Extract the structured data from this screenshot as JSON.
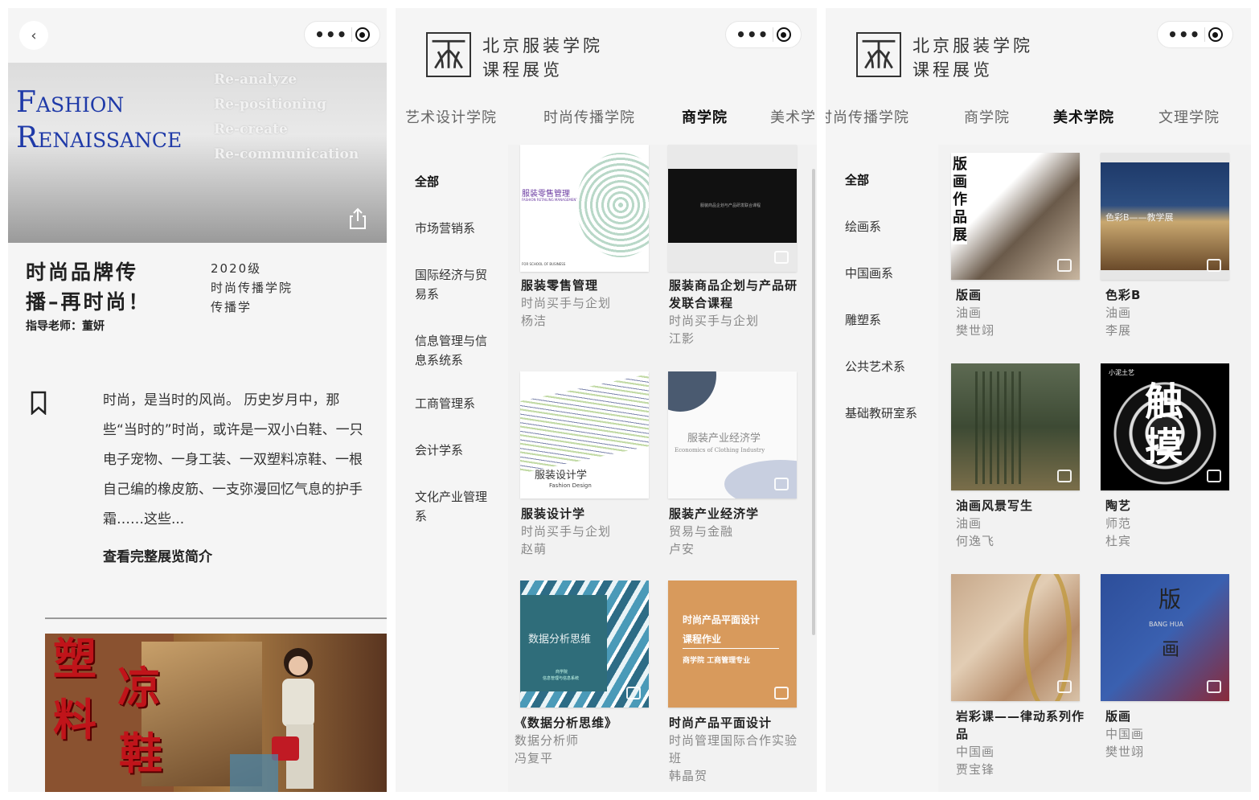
{
  "panel1": {
    "back_glyph": "‹",
    "capsule_dots": "•••",
    "banner": {
      "title_line1": "Fashion",
      "title_line2": "Renaissance",
      "words": [
        "Re-analyze",
        "Re-positioning",
        "Re-create",
        "Re-communication"
      ]
    },
    "title_line1": "时尚品牌传",
    "title_line2": "播–再时尚！",
    "teacher": "指导老师：董妍",
    "meta": [
      "2020级",
      "时尚传播学院",
      "传播学"
    ],
    "description": "时尚，是当时的风尚。 历史岁月中，那些“当时的”时尚，或许是一双小白鞋、一只电子宠物、一身工装、一双塑料凉鞋、一根自己编的橡皮筋、一支弥漫回忆气息的护手霜……这些...",
    "link": "查看完整展览简介",
    "poster_chars": [
      "塑",
      "料",
      "凉",
      "鞋"
    ]
  },
  "header": {
    "school_line1": "北京服装学院",
    "school_line2": "课程展览"
  },
  "panel2": {
    "tabs": [
      "艺术设计学院",
      "时尚传播学院",
      "商学院",
      "美术学"
    ],
    "active_tab": 2,
    "side": [
      "全部",
      "市场营销系",
      "国际经济与贸易系",
      "信息管理与信息系统系",
      "工商管理系",
      "会计学系",
      "文化产业管理系"
    ],
    "cards": [
      {
        "title": "服装零售管理",
        "lines": [
          "时尚买手与企划",
          "杨洁"
        ],
        "cover_text": "服装零售管理",
        "cover_sub": "FASHION RETAILING MANAGEMENT",
        "cover_foot": "FOR SCHOOL OF BUSINESS"
      },
      {
        "title": "服装商品企划与产品研发联合课程",
        "lines": [
          "时尚买手与企划",
          "江影"
        ],
        "cover_text": "服装商品企划与产品研发联合课程"
      },
      {
        "title": "服装设计学",
        "lines": [
          "时尚买手与企划",
          "赵萌"
        ],
        "cover_text": "服装设计学",
        "cover_sub": "Fashion Design"
      },
      {
        "title": "服装产业经济学",
        "lines": [
          "贸易与金融",
          "卢安"
        ],
        "cover_text": "服装产业经济学",
        "cover_sub": "Economics of Clothing Industry"
      },
      {
        "title": "《数据分析思维》",
        "lines": [
          "数据分析师",
          "冯复平"
        ],
        "cover_text": "数据分析思维",
        "cover_sub": "商学院",
        "cover_sub2": "信息管理与信息系统"
      },
      {
        "title": "时尚产品平面设计",
        "lines": [
          "时尚管理国际合作实验班",
          "韩晶贺"
        ],
        "cover_text": "时尚产品平面设计",
        "cover_text2": "课程作业",
        "cover_sub": "商学院 工商管理专业"
      }
    ]
  },
  "panel3": {
    "tabs": [
      "时尚传播学院",
      "商学院",
      "美术学院",
      "文理学院"
    ],
    "active_tab": 2,
    "side": [
      "全部",
      "绘画系",
      "中国画系",
      "雕塑系",
      "公共艺术系",
      "基础教研室系"
    ],
    "cards": [
      {
        "title": "版画",
        "lines": [
          "油画",
          "樊世翊"
        ],
        "cover_text": "版画作品展"
      },
      {
        "title": "色彩B",
        "lines": [
          "油画",
          "李展"
        ],
        "cover_text": "色彩B——教学展"
      },
      {
        "title": "油画风景写生",
        "lines": [
          "油画",
          "何逸飞"
        ]
      },
      {
        "title": "陶艺",
        "lines": [
          "师范",
          "杜宾"
        ],
        "cover_text": "触摸",
        "cover_sub": "小泥土艺"
      },
      {
        "title": "岩彩课——律动系列作品",
        "lines": [
          "中国画",
          "贾宝锋"
        ]
      },
      {
        "title": "版画",
        "lines": [
          "中国画",
          "樊世翊"
        ],
        "cover_text": "版",
        "cover_text2": "画",
        "cover_sub": "BANG HUA"
      }
    ]
  },
  "colors": {
    "banner_title": "#1f3aa8",
    "poster_red": "#c0141a",
    "active_tab": "#111111",
    "inactive_tab": "#666666"
  }
}
